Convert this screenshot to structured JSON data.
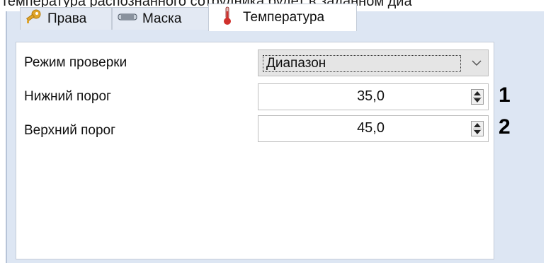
{
  "caption": "температура распознанного сотрудника будет в заданном диа",
  "tabs": [
    {
      "label": "Права",
      "icon": "key-icon"
    },
    {
      "label": "Маска",
      "icon": "mask-icon"
    },
    {
      "label": "Температура",
      "icon": "thermometer-icon",
      "active": true
    }
  ],
  "form": {
    "mode_label": "Режим проверки",
    "mode_value": "Диапазон",
    "lower_label": "Нижний порог",
    "lower_value": "35,0",
    "upper_label": "Верхний порог",
    "upper_value": "45,0"
  },
  "markers": [
    "1",
    "2"
  ],
  "colors": {
    "tab_area": "#dde6f3",
    "panel": "#ffffff",
    "thermometer": "#d0312d",
    "key": "#e0a52b"
  }
}
